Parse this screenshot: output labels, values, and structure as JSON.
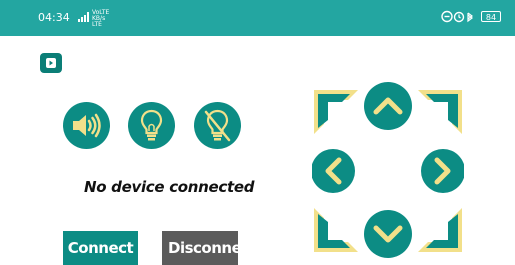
{
  "status_bar": {
    "time": "04:34",
    "network_top": "VoLTE",
    "network_bottom": "KB/s LTE",
    "battery": "84",
    "color": "#23a6a1"
  },
  "controls": {
    "sound_icon": "volume-icon",
    "light_on_icon": "lightbulb-icon",
    "light_off_icon": "lightbulb-off-icon",
    "accent_color": "#0c8c84",
    "arrow_color": "#f2e08a"
  },
  "connection": {
    "status_text": "No device connected",
    "connect_label": "Connect",
    "disconnect_label": "Disconne"
  },
  "dpad": {
    "up_icon": "chevron-up-icon",
    "down_icon": "chevron-down-icon",
    "left_icon": "chevron-left-icon",
    "right_icon": "chevron-right-icon"
  }
}
